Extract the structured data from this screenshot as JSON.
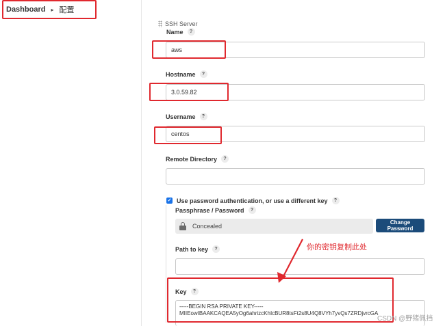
{
  "breadcrumb": {
    "home": "Dashboard",
    "separator": "▸",
    "current": "配置"
  },
  "section": {
    "title": "SSH Server"
  },
  "fields": {
    "name": {
      "label": "Name",
      "value": "aws"
    },
    "hostname": {
      "label": "Hostname",
      "value": "3.0.59.82"
    },
    "username": {
      "label": "Username",
      "value": "centos"
    },
    "remote_directory": {
      "label": "Remote Directory",
      "value": ""
    }
  },
  "help_glyph": "?",
  "auth": {
    "checkbox_label": "Use password authentication, or use a different key",
    "checkbox_checked": true,
    "checkmark": "✓",
    "passphrase_label": "Passphrase / Password",
    "passphrase_value": "Concealed",
    "change_password_button": "Change Password",
    "path_to_key_label": "Path to key",
    "path_to_key_value": "",
    "key_label": "Key",
    "key_line1": "-----BEGIN RSA PRIVATE KEY-----",
    "key_line2": "MIIEowIBAAKCAQEA5yOg6ahrizcKhIcBUR8tsFt2s8U4Q8VYh7yvQs7ZRDjvrcGA"
  },
  "annotation": {
    "text": "你的密钥复制此处",
    "color": "#e0282e"
  },
  "watermark": "CSDN @野猪佩挡",
  "colors": {
    "highlight": "#e0282e",
    "primary_button": "#1b4b7a",
    "checkbox": "#1a73e8"
  }
}
